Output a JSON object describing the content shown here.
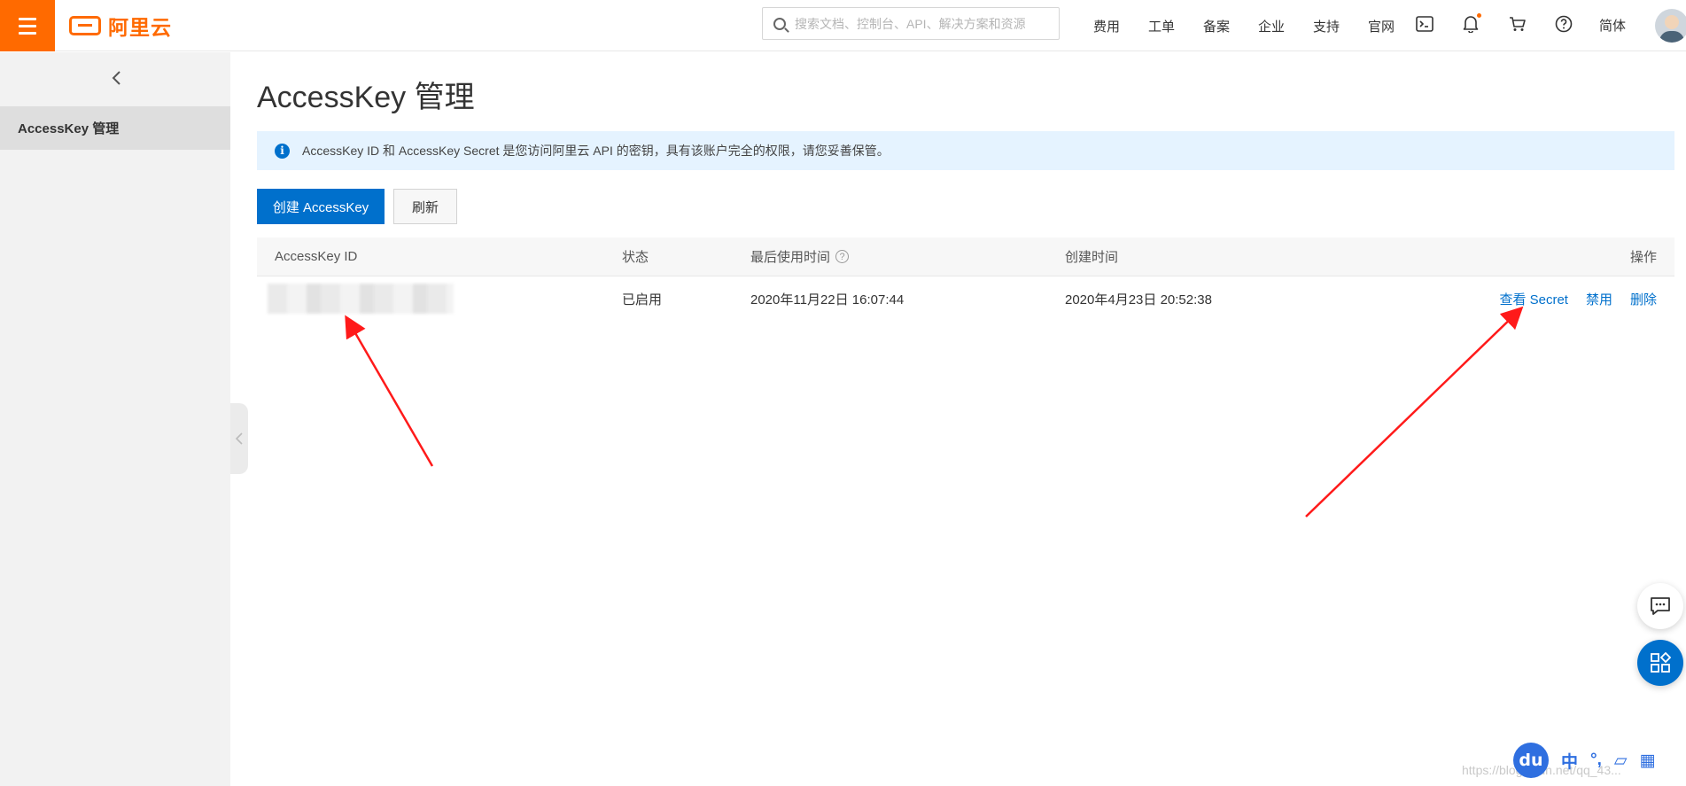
{
  "header": {
    "brand": "阿里云",
    "search_placeholder": "搜索文档、控制台、API、解决方案和资源",
    "nav": [
      "费用",
      "工单",
      "备案",
      "企业",
      "支持",
      "官网"
    ],
    "language": "简体"
  },
  "sidebar": {
    "items": [
      {
        "label": "AccessKey 管理"
      }
    ]
  },
  "main": {
    "title": "AccessKey 管理",
    "notice": "AccessKey ID 和 AccessKey Secret 是您访问阿里云 API 的密钥，具有该账户完全的权限，请您妥善保管。",
    "buttons": {
      "create": "创建 AccessKey",
      "refresh": "刷新"
    },
    "table": {
      "columns": [
        "AccessKey ID",
        "状态",
        "最后使用时间",
        "创建时间",
        "操作"
      ],
      "rows": [
        {
          "status": "已启用",
          "last_used": "2020年11月22日 16:07:44",
          "created": "2020年4月23日 20:52:38",
          "actions": [
            "查看 Secret",
            "禁用",
            "删除"
          ]
        }
      ]
    }
  },
  "ime": {
    "logo": "du",
    "mode": "中"
  },
  "watermark": "https://blog.csdn.net/qq_43..."
}
